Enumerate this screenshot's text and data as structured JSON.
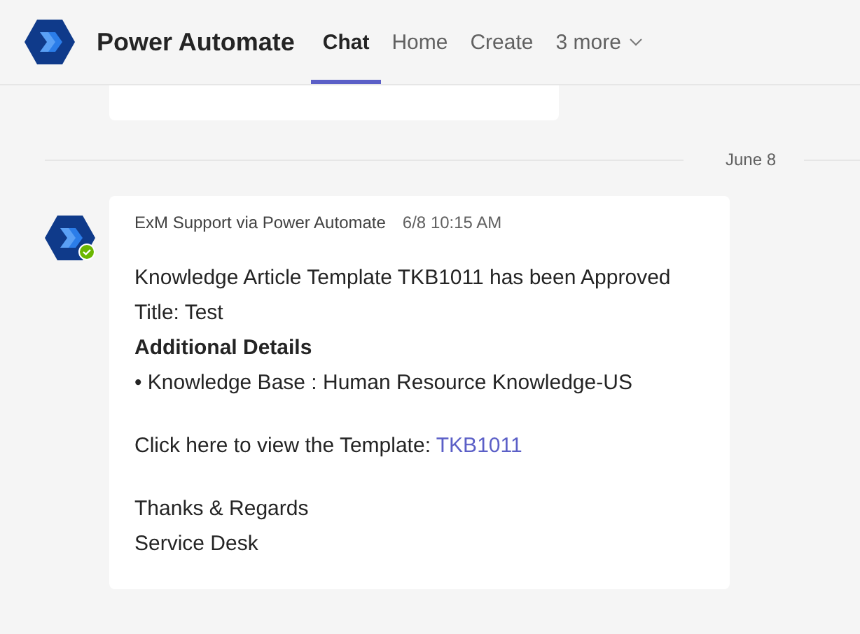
{
  "app": {
    "title": "Power Automate"
  },
  "tabs": [
    {
      "label": "Chat",
      "selected": true,
      "kind": "tab"
    },
    {
      "label": "Home",
      "selected": false,
      "kind": "tab"
    },
    {
      "label": "Create",
      "selected": false,
      "kind": "tab"
    },
    {
      "label": "3 more",
      "selected": false,
      "kind": "more"
    }
  ],
  "date_divider": "June 8",
  "message": {
    "sender": "ExM Support via Power Automate",
    "time": "6/8 10:15 AM",
    "online": true,
    "paragraphs": [
      {
        "lines": [
          {
            "kind": "text",
            "text": "Knowledge Article Template TKB1011 has been Approved"
          },
          {
            "kind": "text",
            "text": "Title: Test"
          },
          {
            "kind": "heading",
            "text": "Additional Details"
          },
          {
            "kind": "text",
            "text": "• Knowledge Base : Human Resource Knowledge-US"
          }
        ]
      },
      {
        "lines": [
          {
            "kind": "link_line",
            "text": "Click here to view the Template:",
            "link": "TKB1011"
          }
        ]
      },
      {
        "lines": [
          {
            "kind": "text",
            "text": "Thanks & Regards"
          },
          {
            "kind": "text",
            "text": "Service Desk"
          }
        ]
      }
    ]
  }
}
